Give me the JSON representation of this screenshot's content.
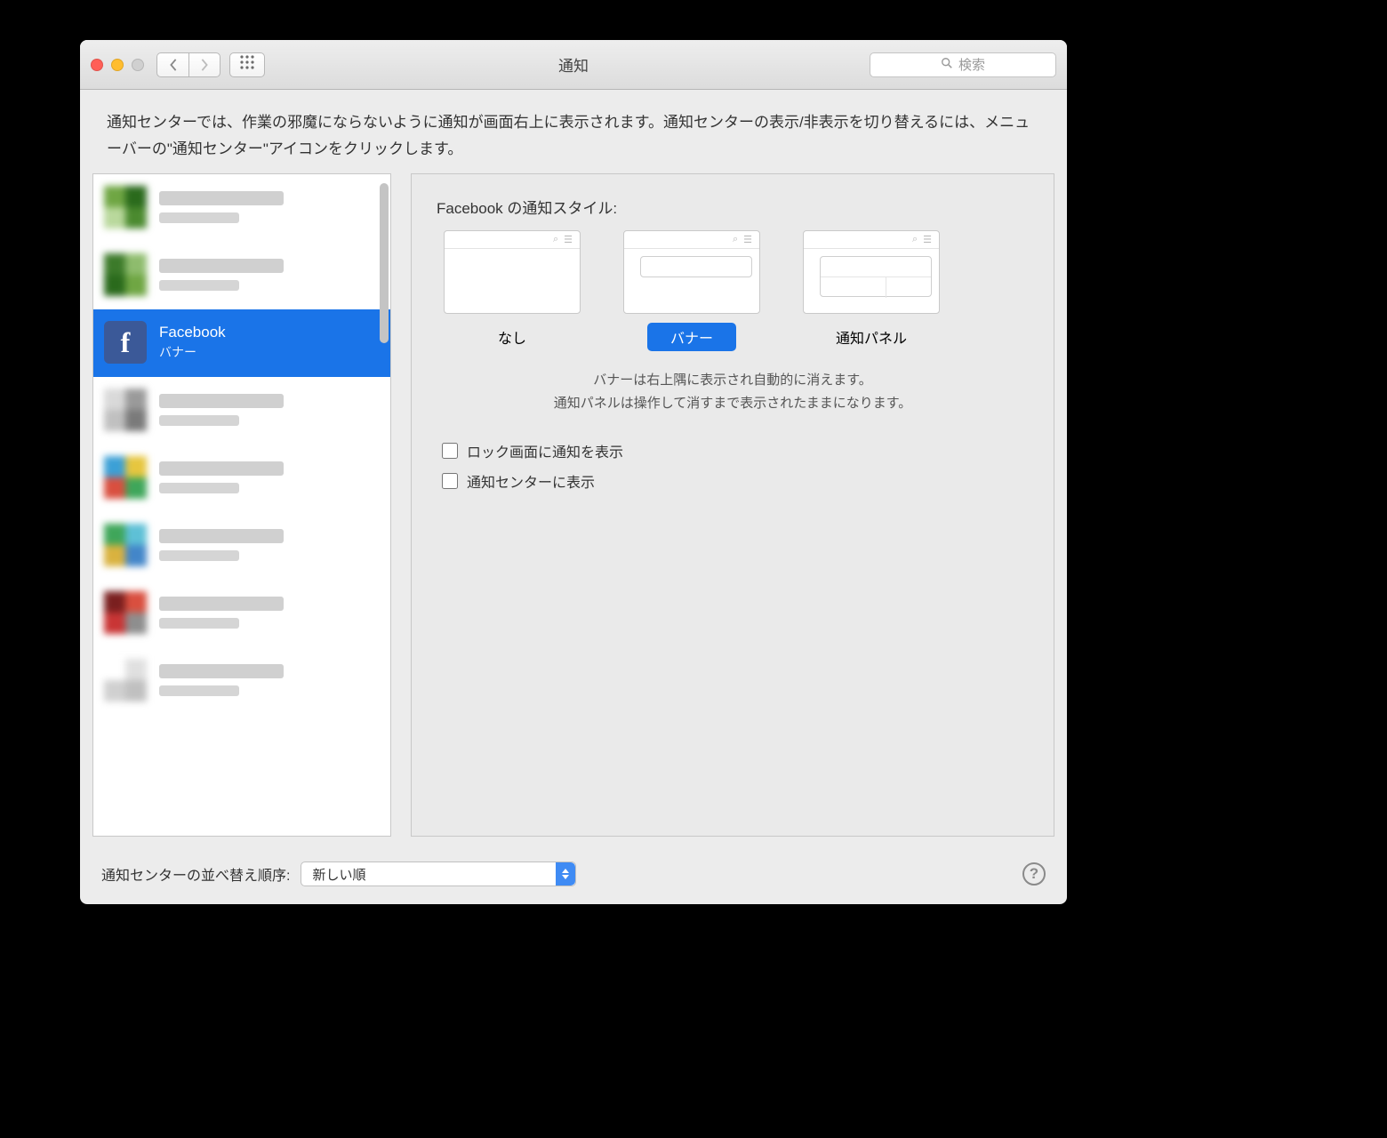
{
  "window": {
    "title": "通知"
  },
  "search": {
    "placeholder": "検索"
  },
  "description": "通知センターでは、作業の邪魔にならないように通知が画面右上に表示されます。通知センターの表示/非表示を切り替えるには、メニューバーの\"通知センター\"アイコンをクリックします。",
  "sidebar": {
    "selected_index": 2,
    "items": [
      {
        "name": "",
        "sub": "",
        "blurred": true,
        "icon_colors": [
          "#6fa643",
          "#2a6a1c",
          "#b9d89c",
          "#4b8a2f"
        ]
      },
      {
        "name": "",
        "sub": "",
        "blurred": true,
        "icon_colors": [
          "#3c7a2a",
          "#8ebc6d",
          "#2a6a1c",
          "#6fa643"
        ]
      },
      {
        "name": "Facebook",
        "sub": "バナー",
        "blurred": false,
        "icon": "fb"
      },
      {
        "name": "",
        "sub": "",
        "blurred": true,
        "icon_colors": [
          "#d9d9d9",
          "#9a9a9a",
          "#c0c0c0",
          "#7a7a7a"
        ]
      },
      {
        "name": "",
        "sub": "",
        "blurred": true,
        "icon_colors": [
          "#3ca0d6",
          "#e6c63f",
          "#d94f3f",
          "#3fa65a"
        ]
      },
      {
        "name": "",
        "sub": "",
        "blurred": true,
        "icon_colors": [
          "#3fa65a",
          "#5ec0d6",
          "#d9b23f",
          "#4386c9"
        ]
      },
      {
        "name": "",
        "sub": "",
        "blurred": true,
        "icon_colors": [
          "#7a1f1f",
          "#d94f3f",
          "#c93535",
          "#8e8e8e"
        ]
      },
      {
        "name": "",
        "sub": "",
        "blurred": true,
        "icon_colors": [
          "#ffffff",
          "#e0e0e0",
          "#d0d0d0",
          "#c0c0c0"
        ]
      }
    ]
  },
  "detail": {
    "style_title": "Facebook の通知スタイル:",
    "styles": [
      {
        "key": "none",
        "label": "なし"
      },
      {
        "key": "banner",
        "label": "バナー"
      },
      {
        "key": "alert",
        "label": "通知パネル"
      }
    ],
    "selected_style": "banner",
    "note_line1": "バナーは右上隅に表示され自動的に消えます。",
    "note_line2": "通知パネルは操作して消すまで表示されたままになります。",
    "check_lock": "ロック画面に通知を表示",
    "check_center": "通知センターに表示",
    "check_lock_value": false,
    "check_center_value": false
  },
  "footer": {
    "sort_label": "通知センターの並べ替え順序:",
    "sort_value": "新しい順"
  }
}
